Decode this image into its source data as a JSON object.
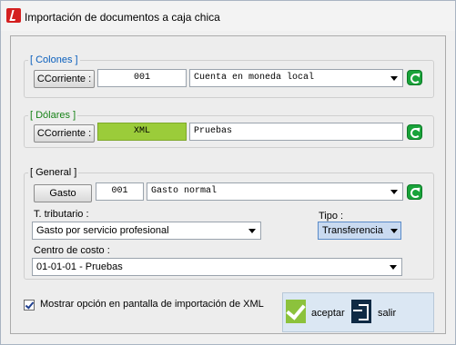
{
  "window": {
    "title": "Importación de documentos a caja chica"
  },
  "colones": {
    "legend": "[ Colones ]",
    "account_button": "CCorriente :",
    "code": "001",
    "description": "Cuenta en moneda local"
  },
  "dolares": {
    "legend": "[ Dólares ]",
    "account_button": "CCorriente :",
    "code": "XML",
    "description": "Pruebas"
  },
  "general": {
    "legend": "[ General ]",
    "expense_button": "Gasto",
    "code": "001",
    "description": "Gasto normal",
    "tax_label": "T. tributario :",
    "tax_value": "Gasto por servicio profesional",
    "type_label": "Tipo :",
    "type_value": "Transferencia",
    "cost_center_label": "Centro de costo :",
    "cost_center_value": "01-01-01 - Pruebas"
  },
  "options": {
    "show_option_label": "Mostrar opción en pantalla de importación de XML",
    "show_option_checked": true
  },
  "actions": {
    "accept": "aceptar",
    "exit": "salir"
  },
  "colors": {
    "accent_green": "#9bcc3a",
    "legend_blue": "#0a5fbd",
    "legend_green": "#178217"
  }
}
